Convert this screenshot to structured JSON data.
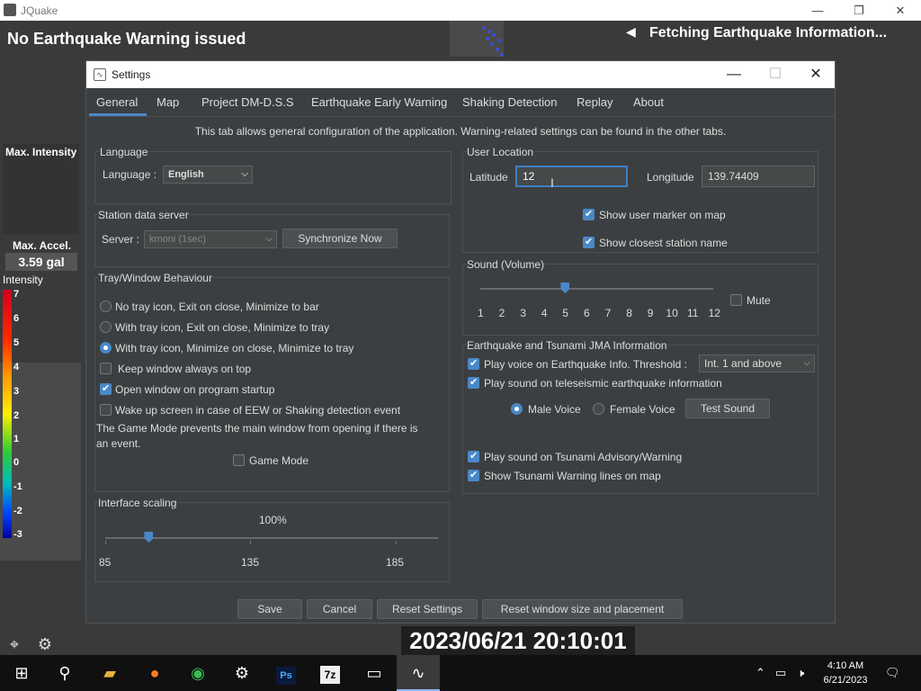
{
  "app": {
    "title": "JQuake",
    "warning_status": "No Earthquake Warning issued",
    "fetch_status": "Fetching Earthquake Information...",
    "max_intensity_label": "Max. Intensity",
    "max_accel_label": "Max. Accel.",
    "max_accel_value": "3.59 gal",
    "intensity_label": "Intensity",
    "intensity_scale": [
      "7",
      "6",
      "5",
      "4",
      "3",
      "2",
      "1",
      "0",
      "-1",
      "-2",
      "-3"
    ],
    "datetime": "2023/06/21 20:10:01"
  },
  "dialog": {
    "title": "Settings",
    "tabs": [
      "General",
      "Map",
      "Project DM-D.S.S",
      "Earthquake Early Warning",
      "Shaking Detection",
      "Replay",
      "About"
    ],
    "active_tab": "General",
    "description": "This tab allows general configuration of the application. Warning-related settings can be found in the other tabs.",
    "language": {
      "group_title": "Language",
      "label": "Language :",
      "value": "English"
    },
    "station": {
      "group_title": "Station data server",
      "label": "Server :",
      "value": "kmoni (1sec)",
      "sync_button": "Synchronize Now"
    },
    "tray": {
      "group_title": "Tray/Window Behaviour",
      "options": [
        {
          "label": "No tray icon, Exit on close, Minimize to bar",
          "selected": false
        },
        {
          "label": "With tray icon, Exit on close, Minimize to tray",
          "selected": false
        },
        {
          "label": "With tray icon, Minimize on close, Minimize to tray",
          "selected": true
        }
      ],
      "checkboxes": [
        {
          "label": "Keep window always on top",
          "checked": false
        },
        {
          "label": "Open window on program startup",
          "checked": true
        },
        {
          "label": "Wake up screen in case of EEW or Shaking detection event",
          "checked": false
        }
      ],
      "game_mode_note_line1": "The Game Mode prevents the main window from opening if there is",
      "game_mode_note_line2": "an event.",
      "game_mode_label": "Game Mode"
    },
    "scaling": {
      "group_title": "Interface scaling",
      "value_label": "100%",
      "min": "85",
      "mid": "135",
      "max": "185",
      "value": 100
    },
    "location": {
      "group_title": "User Location",
      "latitude_label": "Latitude",
      "latitude_value": "12",
      "longitude_label": "Longitude",
      "longitude_value": "139.74409",
      "show_marker": "Show user marker on map",
      "show_station": "Show closest station name"
    },
    "sound": {
      "group_title": "Sound (Volume)",
      "ticks": [
        "1",
        "2",
        "3",
        "4",
        "5",
        "6",
        "7",
        "8",
        "9",
        "10",
        "11",
        "12"
      ],
      "volume": 5,
      "mute_label": "Mute"
    },
    "jma": {
      "group_title": "Earthquake and Tsunami JMA Information",
      "play_voice": "Play voice on Earthquake Info. Threshold :",
      "threshold_value": "Int. 1 and above",
      "play_teleseismic": "Play sound on teleseismic earthquake information",
      "male_voice": "Male Voice",
      "female_voice": "Female Voice",
      "test_sound": "Test Sound",
      "tsunami_sound": "Play sound on Tsunami Advisory/Warning",
      "tsunami_lines": "Show Tsunami Warning lines on map"
    },
    "buttons": {
      "save": "Save",
      "cancel": "Cancel",
      "reset": "Reset Settings",
      "reset_window": "Reset window size and placement"
    }
  },
  "taskbar": {
    "time": "4:10 AM",
    "date": "6/21/2023",
    "apps": [
      "start-icon",
      "search-icon",
      "file-explorer-icon",
      "firefox-icon",
      "chrome-icon",
      "settings-icon",
      "photoshop-icon",
      "7zip-icon",
      "terminal-icon",
      "jquake-icon"
    ],
    "photoshop_label": "Ps",
    "sevenzip_label": "7z"
  }
}
